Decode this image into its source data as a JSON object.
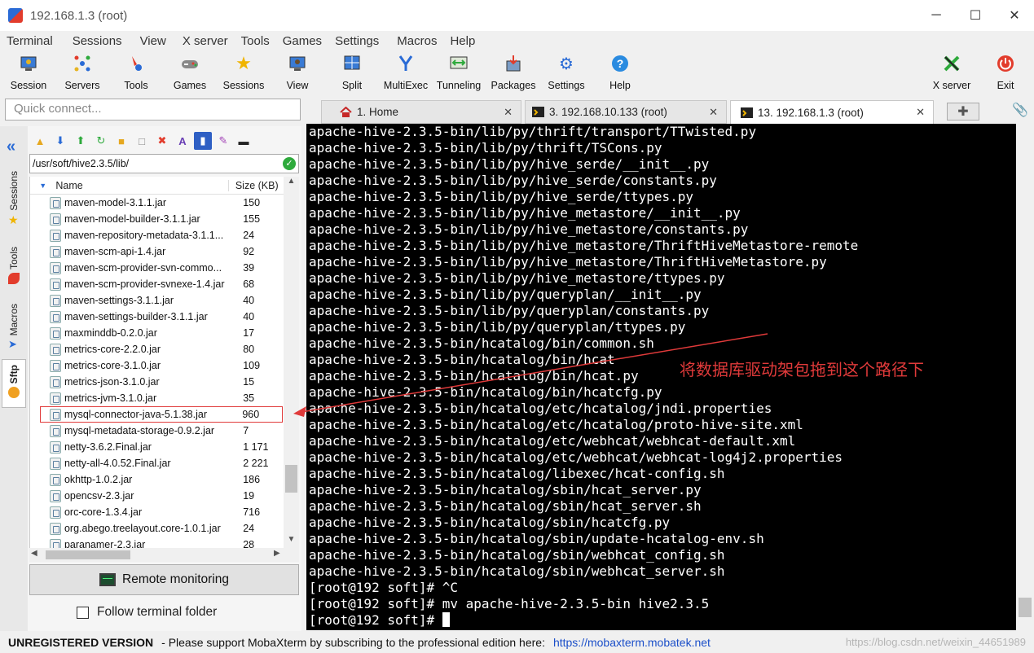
{
  "window": {
    "title": "192.168.1.3 (root)",
    "minimize": "─",
    "maximize": "☐",
    "close": "✕"
  },
  "menu": [
    "Terminal",
    "Sessions",
    "View",
    "X server",
    "Tools",
    "Games",
    "Settings",
    "Macros",
    "Help"
  ],
  "toolbar": {
    "items": [
      "Session",
      "Servers",
      "Tools",
      "Games",
      "Sessions",
      "View",
      "Split",
      "MultiExec",
      "Tunneling",
      "Packages",
      "Settings",
      "Help"
    ],
    "right_items": [
      "X server",
      "Exit"
    ]
  },
  "quick_connect": {
    "placeholder": "Quick connect..."
  },
  "side_tabs": [
    "Sessions",
    "Tools",
    "Macros",
    "Sftp"
  ],
  "sftp": {
    "path": "/usr/soft/hive2.3.5/lib/",
    "columns": {
      "name": "Name",
      "size": "Size (KB)"
    },
    "files": [
      {
        "name": "maven-model-3.1.1.jar",
        "size": "150"
      },
      {
        "name": "maven-model-builder-3.1.1.jar",
        "size": "155"
      },
      {
        "name": "maven-repository-metadata-3.1.1...",
        "size": "24"
      },
      {
        "name": "maven-scm-api-1.4.jar",
        "size": "92"
      },
      {
        "name": "maven-scm-provider-svn-commo...",
        "size": "39"
      },
      {
        "name": "maven-scm-provider-svnexe-1.4.jar",
        "size": "68"
      },
      {
        "name": "maven-settings-3.1.1.jar",
        "size": "40"
      },
      {
        "name": "maven-settings-builder-3.1.1.jar",
        "size": "40"
      },
      {
        "name": "maxminddb-0.2.0.jar",
        "size": "17"
      },
      {
        "name": "metrics-core-2.2.0.jar",
        "size": "80"
      },
      {
        "name": "metrics-core-3.1.0.jar",
        "size": "109"
      },
      {
        "name": "metrics-json-3.1.0.jar",
        "size": "15"
      },
      {
        "name": "metrics-jvm-3.1.0.jar",
        "size": "35"
      },
      {
        "name": "mysql-connector-java-5.1.38.jar",
        "size": "960"
      },
      {
        "name": "mysql-metadata-storage-0.9.2.jar",
        "size": "7"
      },
      {
        "name": "netty-3.6.2.Final.jar",
        "size": "1 171"
      },
      {
        "name": "netty-all-4.0.52.Final.jar",
        "size": "2 221"
      },
      {
        "name": "okhttp-1.0.2.jar",
        "size": "186"
      },
      {
        "name": "opencsv-2.3.jar",
        "size": "19"
      },
      {
        "name": "orc-core-1.3.4.jar",
        "size": "716"
      },
      {
        "name": "org.abego.treelayout.core-1.0.1.jar",
        "size": "24"
      },
      {
        "name": "paranamer-2.3.jar",
        "size": "28"
      }
    ],
    "remote_monitoring": "Remote monitoring",
    "follow_folder": "Follow terminal folder"
  },
  "tabs": [
    {
      "label": "1. Home"
    },
    {
      "label": "3. 192.168.10.133 (root)"
    },
    {
      "label": "13. 192.168.1.3 (root)"
    }
  ],
  "terminal": {
    "lines": [
      "apache-hive-2.3.5-bin/lib/py/thrift/transport/TTwisted.py",
      "apache-hive-2.3.5-bin/lib/py/thrift/TSCons.py",
      "apache-hive-2.3.5-bin/lib/py/hive_serde/__init__.py",
      "apache-hive-2.3.5-bin/lib/py/hive_serde/constants.py",
      "apache-hive-2.3.5-bin/lib/py/hive_serde/ttypes.py",
      "apache-hive-2.3.5-bin/lib/py/hive_metastore/__init__.py",
      "apache-hive-2.3.5-bin/lib/py/hive_metastore/constants.py",
      "apache-hive-2.3.5-bin/lib/py/hive_metastore/ThriftHiveMetastore-remote",
      "apache-hive-2.3.5-bin/lib/py/hive_metastore/ThriftHiveMetastore.py",
      "apache-hive-2.3.5-bin/lib/py/hive_metastore/ttypes.py",
      "apache-hive-2.3.5-bin/lib/py/queryplan/__init__.py",
      "apache-hive-2.3.5-bin/lib/py/queryplan/constants.py",
      "apache-hive-2.3.5-bin/lib/py/queryplan/ttypes.py",
      "apache-hive-2.3.5-bin/hcatalog/bin/common.sh",
      "apache-hive-2.3.5-bin/hcatalog/bin/hcat",
      "apache-hive-2.3.5-bin/hcatalog/bin/hcat.py",
      "apache-hive-2.3.5-bin/hcatalog/bin/hcatcfg.py",
      "apache-hive-2.3.5-bin/hcatalog/etc/hcatalog/jndi.properties",
      "apache-hive-2.3.5-bin/hcatalog/etc/hcatalog/proto-hive-site.xml",
      "apache-hive-2.3.5-bin/hcatalog/etc/webhcat/webhcat-default.xml",
      "apache-hive-2.3.5-bin/hcatalog/etc/webhcat/webhcat-log4j2.properties",
      "apache-hive-2.3.5-bin/hcatalog/libexec/hcat-config.sh",
      "apache-hive-2.3.5-bin/hcatalog/sbin/hcat_server.py",
      "apache-hive-2.3.5-bin/hcatalog/sbin/hcat_server.sh",
      "apache-hive-2.3.5-bin/hcatalog/sbin/hcatcfg.py",
      "apache-hive-2.3.5-bin/hcatalog/sbin/update-hcatalog-env.sh",
      "apache-hive-2.3.5-bin/hcatalog/sbin/webhcat_config.sh",
      "apache-hive-2.3.5-bin/hcatalog/sbin/webhcat_server.sh",
      "[root@192 soft]# ^C",
      "[root@192 soft]# mv apache-hive-2.3.5-bin hive2.3.5"
    ],
    "prompt": "[root@192 soft]# ",
    "annotation": "将数据库驱动架包拖到这个路径下"
  },
  "status": {
    "unregistered": "UNREGISTERED VERSION",
    "message": "-   Please support MobaXterm by subscribing to the professional edition here:",
    "link": "https://mobaxterm.mobatek.net",
    "watermark": "https://blog.csdn.net/weixin_44651989"
  },
  "colors": {
    "accent": "#2a6bd6",
    "annotation": "#e03a3a",
    "terminal_bg": "#000000",
    "terminal_fg": "#ffffff"
  }
}
